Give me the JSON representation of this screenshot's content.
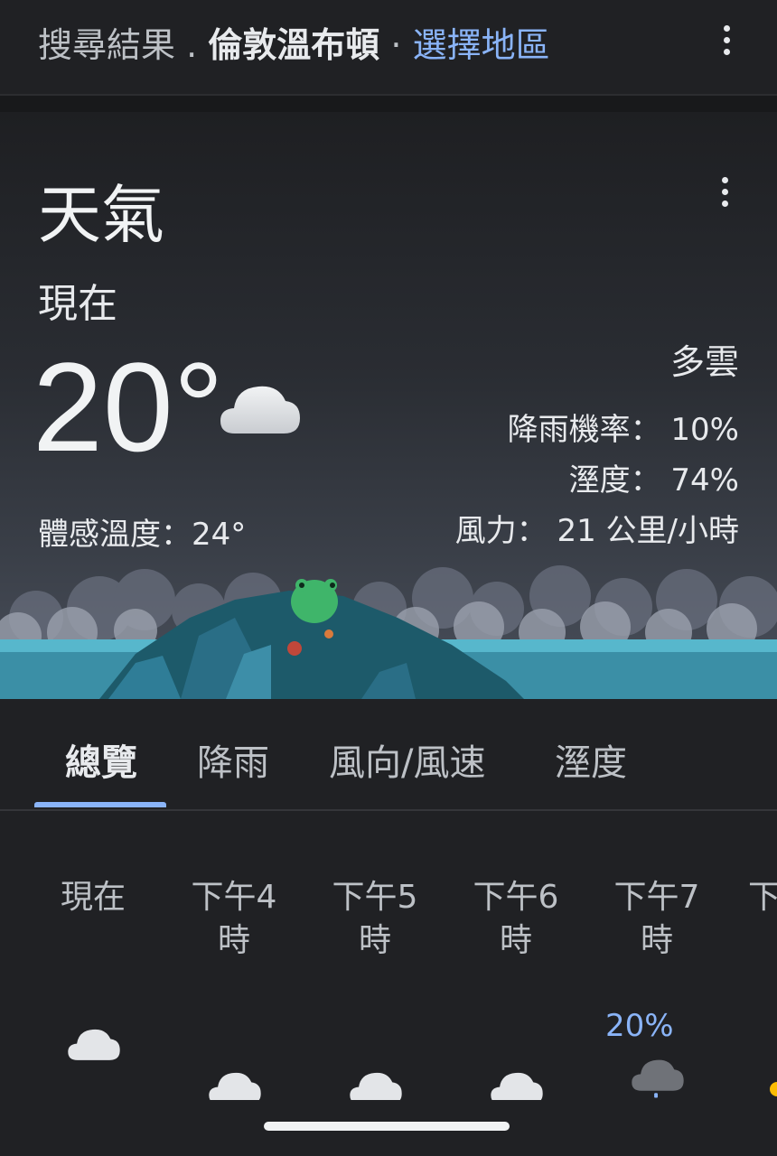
{
  "header": {
    "prefix": "搜尋結果",
    "separator": ".",
    "location": "倫敦溫布頓",
    "separator2": "·",
    "choose_region": "選擇地區"
  },
  "weather": {
    "title": "天氣",
    "now_label": "現在",
    "temperature": "20°",
    "feels_like": "體感溫度：24°",
    "condition": "多雲",
    "precipitation": "降雨機率： 10%",
    "humidity": "溼度： 74%",
    "wind": "風力： 21 公里/小時",
    "condition_icon": "cloud-icon"
  },
  "tabs": [
    {
      "label": "總覽",
      "active": true
    },
    {
      "label": "降雨",
      "active": false
    },
    {
      "label": "風向/風速",
      "active": false
    },
    {
      "label": "溼度",
      "active": false
    }
  ],
  "hourly": [
    {
      "line1": "現在",
      "line2": "",
      "precip": "",
      "icon": "cloud-icon"
    },
    {
      "line1": "下午4",
      "line2": "時",
      "precip": "",
      "icon": "cloud-icon"
    },
    {
      "line1": "下午5",
      "line2": "時",
      "precip": "",
      "icon": "cloud-icon"
    },
    {
      "line1": "下午6",
      "line2": "時",
      "precip": "",
      "icon": "cloud-icon"
    },
    {
      "line1": "下午7",
      "line2": "時",
      "precip": "20%",
      "icon": "rain-cloud-icon"
    },
    {
      "line1": "下",
      "line2": "",
      "precip": "",
      "icon": "sun-icon"
    }
  ],
  "colors": {
    "background": "#202124",
    "link": "#8ab4f8",
    "text": "#e8eaed"
  }
}
